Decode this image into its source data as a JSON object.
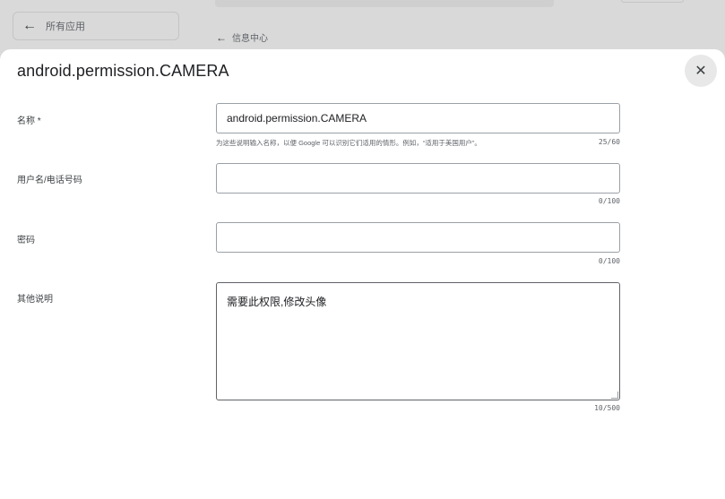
{
  "background": {
    "back_label": "所有应用",
    "breadcrumb_label": "信息中心"
  },
  "dialog": {
    "title": "android.permission.CAMERA",
    "close_glyph": "✕"
  },
  "form": {
    "name": {
      "label": "名称 *",
      "value": "android.permission.CAMERA",
      "hint": "为这些说明输入名称，以便 Google 可以识别它们适用的情形。例如，“适用于美国用户”。",
      "counter": "25/60"
    },
    "username": {
      "label": "用户名/电话号码",
      "value": "",
      "counter": "0/100"
    },
    "password": {
      "label": "密码",
      "value": "",
      "counter": "0/100"
    },
    "notes": {
      "label": "其他说明",
      "value": "需要此权限,修改头像",
      "counter": "10/500"
    }
  },
  "colors": {
    "backdrop": "#d9d9d9",
    "dialog_bg": "#ffffff",
    "close_bg": "#e8e8e8",
    "field_border": "#9aa0a6"
  }
}
